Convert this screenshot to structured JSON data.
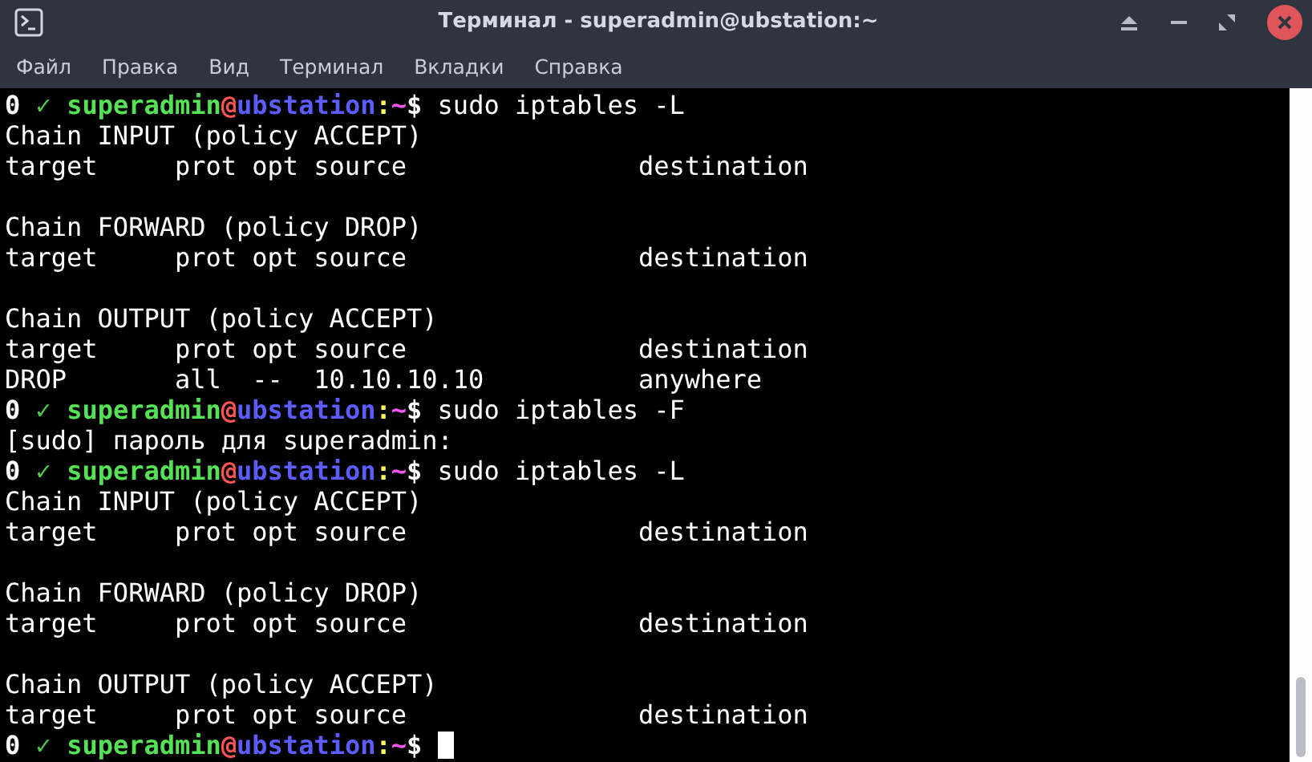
{
  "window": {
    "title": "Терминал - superadmin@ubstation:~"
  },
  "menu": [
    "Файл",
    "Правка",
    "Вид",
    "Терминал",
    "Вкладки",
    "Справка"
  ],
  "terminal": {
    "lines": [
      {
        "kind": "prompt",
        "status": "0",
        "check": "✓",
        "user": "superadmin",
        "at": "@",
        "host": "ubstation",
        "colon": ":",
        "path": "~",
        "symbol": "$",
        "command": "sudo iptables -L"
      },
      {
        "kind": "output",
        "text": "Chain INPUT (policy ACCEPT)"
      },
      {
        "kind": "output",
        "text": "target     prot opt source               destination"
      },
      {
        "kind": "blank"
      },
      {
        "kind": "output",
        "text": "Chain FORWARD (policy DROP)"
      },
      {
        "kind": "output",
        "text": "target     prot opt source               destination"
      },
      {
        "kind": "blank"
      },
      {
        "kind": "output",
        "text": "Chain OUTPUT (policy ACCEPT)"
      },
      {
        "kind": "output",
        "text": "target     prot opt source               destination"
      },
      {
        "kind": "output",
        "text": "DROP       all  --  10.10.10.10          anywhere"
      },
      {
        "kind": "prompt",
        "status": "0",
        "check": "✓",
        "user": "superadmin",
        "at": "@",
        "host": "ubstation",
        "colon": ":",
        "path": "~",
        "symbol": "$",
        "command": "sudo iptables -F"
      },
      {
        "kind": "output",
        "text": "[sudo] пароль для superadmin:"
      },
      {
        "kind": "prompt",
        "status": "0",
        "check": "✓",
        "user": "superadmin",
        "at": "@",
        "host": "ubstation",
        "colon": ":",
        "path": "~",
        "symbol": "$",
        "command": "sudo iptables -L"
      },
      {
        "kind": "output",
        "text": "Chain INPUT (policy ACCEPT)"
      },
      {
        "kind": "output",
        "text": "target     prot opt source               destination"
      },
      {
        "kind": "blank"
      },
      {
        "kind": "output",
        "text": "Chain FORWARD (policy DROP)"
      },
      {
        "kind": "output",
        "text": "target     prot opt source               destination"
      },
      {
        "kind": "blank"
      },
      {
        "kind": "output",
        "text": "Chain OUTPUT (policy ACCEPT)"
      },
      {
        "kind": "output",
        "text": "target     prot opt source               destination"
      },
      {
        "kind": "active_prompt",
        "status": "0",
        "check": "✓",
        "user": "superadmin",
        "at": "@",
        "host": "ubstation",
        "colon": ":",
        "path": "~",
        "symbol": "$"
      }
    ]
  }
}
